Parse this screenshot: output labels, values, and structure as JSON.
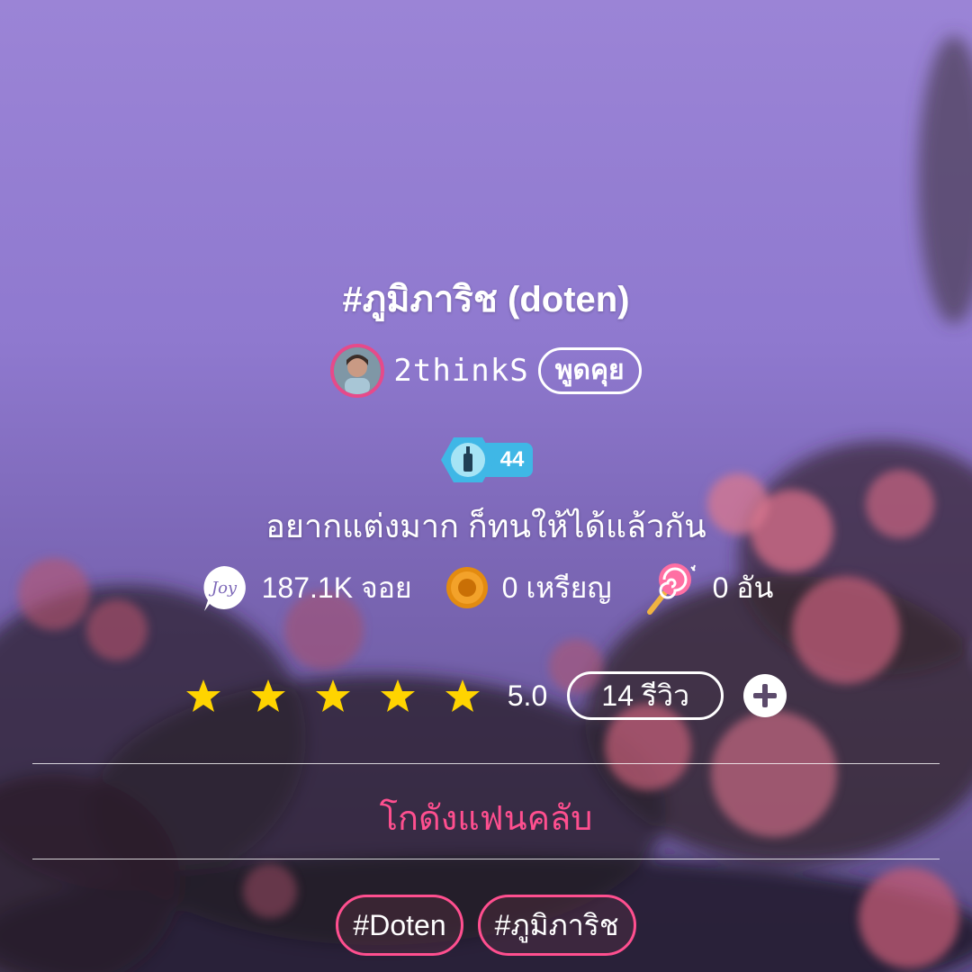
{
  "story": {
    "title": "#ภูมิภาริช (doten)",
    "bio": "อยากแต่งมาก ก็ทนให้ได้แล้วกัน"
  },
  "author": {
    "name": "2thinkS",
    "chat_label": "พูดคุย",
    "level": "44"
  },
  "stats": {
    "joy": "187.1K จอย",
    "coins": "0 เหรียญ",
    "candy": "0 อัน"
  },
  "rating": {
    "stars": 5,
    "value": "5.0",
    "reviews_label": "14 รีวิว"
  },
  "fanclub_label": "โกดังแฟนคลับ",
  "tags": [
    "#Doten",
    "#ภูมิภาริช"
  ],
  "colors": {
    "accent_pink": "#ff4f8f",
    "star_yellow": "#ffd400",
    "level_blue": "#3fb7e6"
  }
}
